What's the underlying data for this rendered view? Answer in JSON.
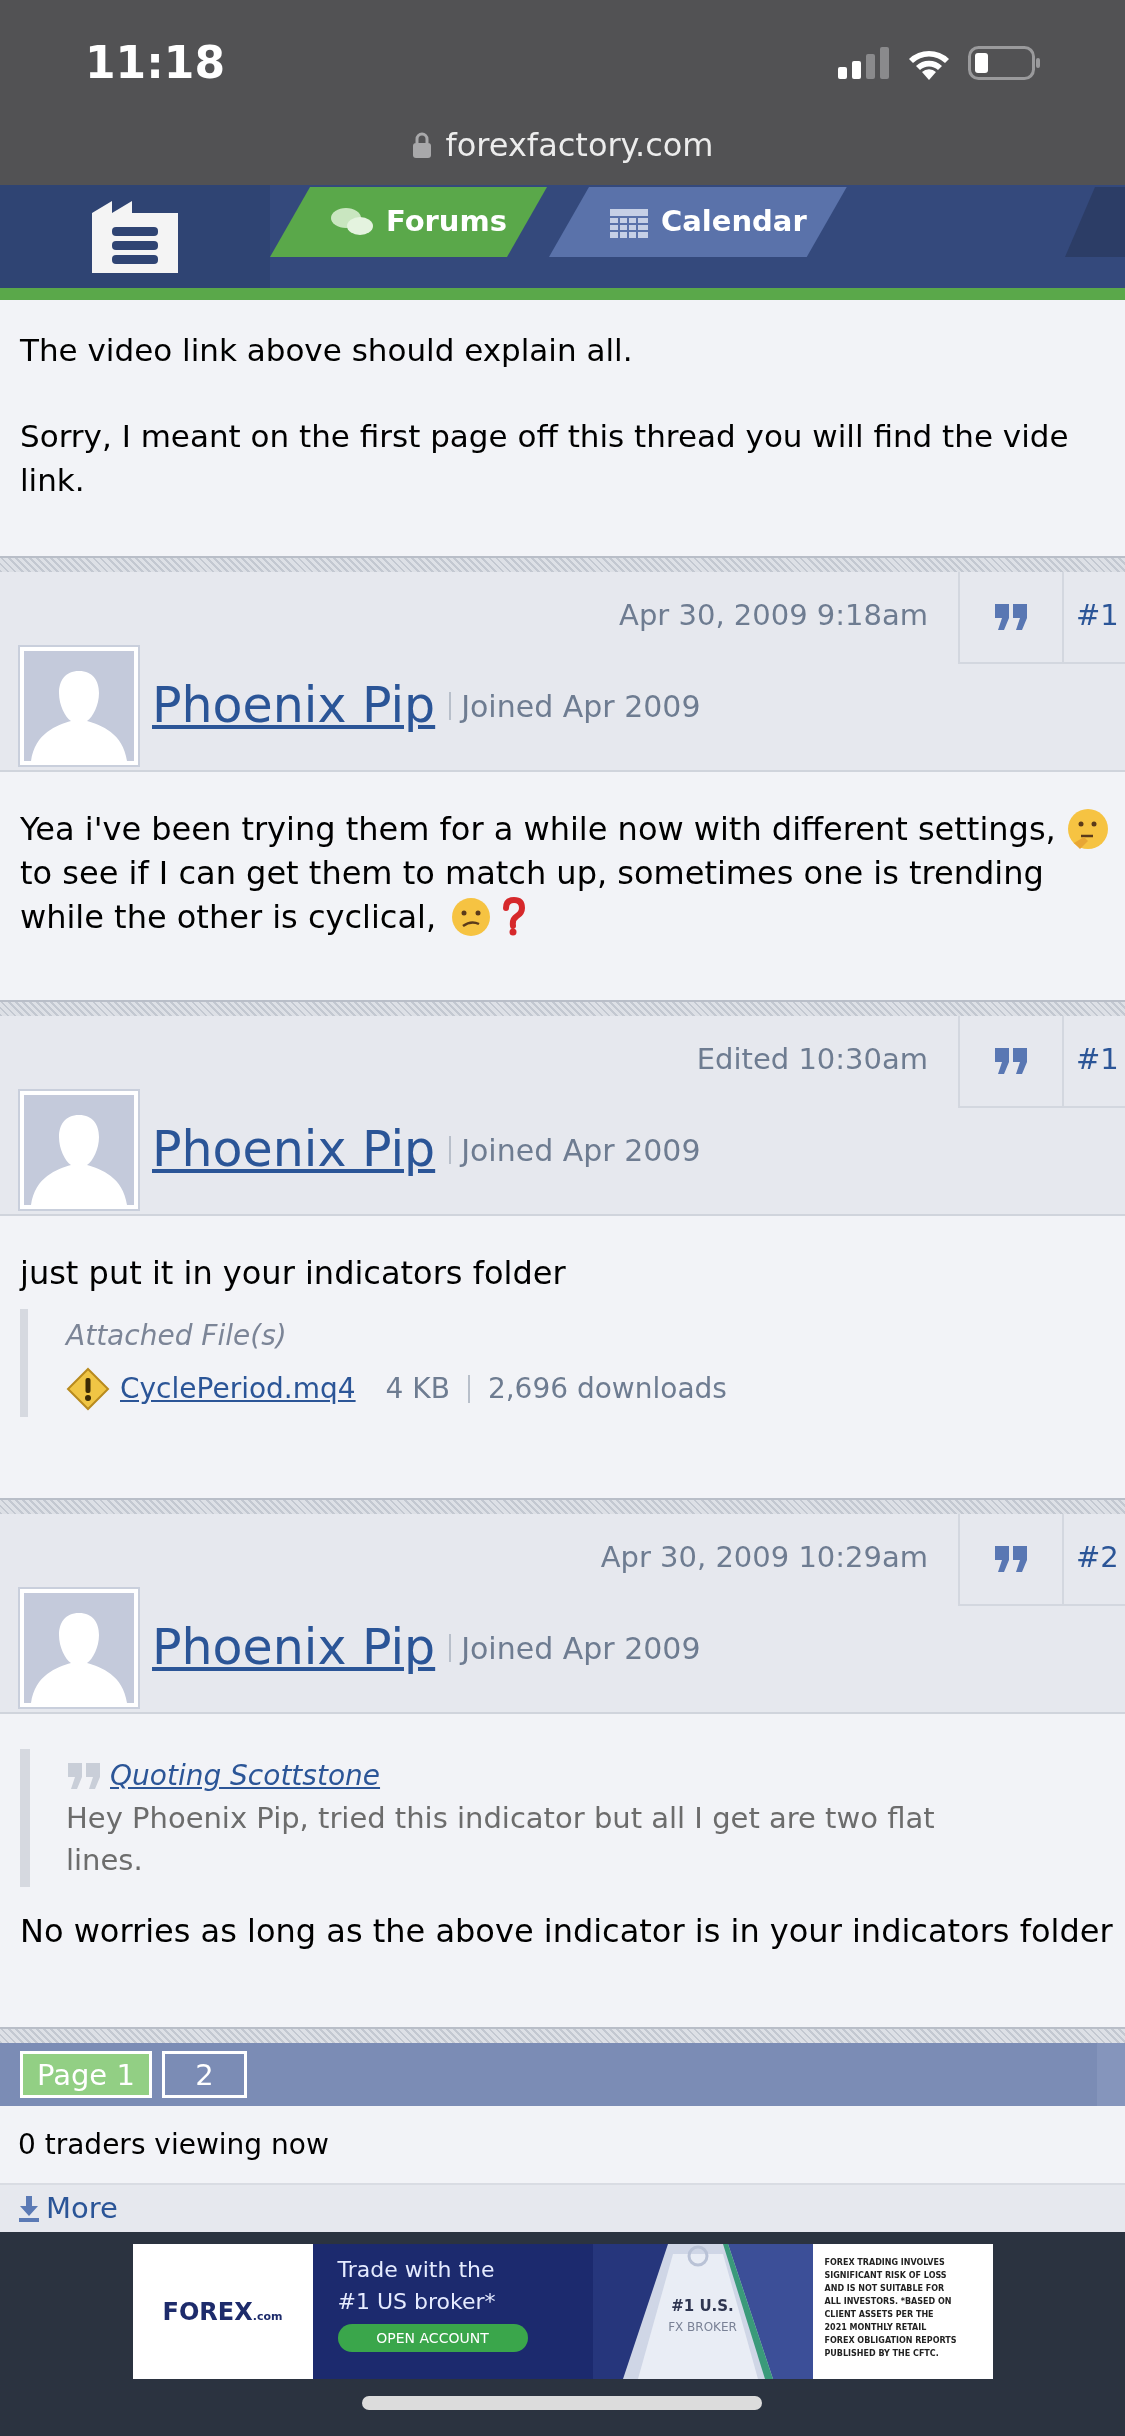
{
  "status_bar": {
    "time": "11:18"
  },
  "address_bar": {
    "url": "forexfactory.com"
  },
  "nav": {
    "tabs": [
      {
        "label": "Forums",
        "selected": true
      },
      {
        "label": "Calendar",
        "selected": false
      }
    ]
  },
  "previous_post_tail": {
    "paragraphs": [
      [
        "The video link above should explain all."
      ],
      [
        "Sorry, I meant on the first page off this thread you will find the vide",
        "link."
      ]
    ]
  },
  "posts": [
    {
      "date": "Apr 30, 2009 9:18am",
      "number": "#1",
      "author": "Phoenix Pip",
      "joined": "Joined Apr 2009",
      "body": [
        {
          "kind": "paragraph",
          "lines": [
            [
              {
                "kind": "text",
                "text": "Yea i've been trying them for a while now with different settings,"
              },
              {
                "kind": "thinking"
              }
            ],
            [
              {
                "kind": "text",
                "text": "to see if I can get them to match up, sometimes one is trending"
              }
            ],
            [
              {
                "kind": "text",
                "text": "while the other is cyclical,"
              },
              {
                "kind": "confused"
              },
              {
                "kind": "question"
              }
            ]
          ]
        }
      ]
    },
    {
      "date": "Edited 10:30am",
      "number": "#1",
      "author": "Phoenix Pip",
      "joined": "Joined Apr 2009",
      "body": [
        {
          "kind": "paragraph",
          "lines": [
            [
              {
                "kind": "text",
                "text": "just put it in your indicators folder"
              }
            ]
          ]
        },
        {
          "kind": "attachments",
          "title": "Attached File(s)",
          "files": [
            {
              "name": "CyclePeriod.mq4",
              "size": "4 KB",
              "downloads": "2,696 downloads"
            }
          ]
        }
      ]
    },
    {
      "date": "Apr 30, 2009 10:29am",
      "number": "#2",
      "author": "Phoenix Pip",
      "joined": "Joined Apr 2009",
      "body": [
        {
          "kind": "quote",
          "link": "Quoting Scottstone",
          "lines": [
            "Hey Phoenix Pip, tried this indicator but all I get are two flat",
            "lines."
          ]
        },
        {
          "kind": "paragraph",
          "lines": [
            [
              {
                "kind": "text",
                "text": "No worries as long as the above indicator is in your indicators folder"
              }
            ]
          ]
        }
      ]
    }
  ],
  "pagination": {
    "pages": [
      {
        "label": "Page 1",
        "selected": true
      },
      {
        "label": "2",
        "selected": false
      }
    ]
  },
  "viewers": "0 traders viewing now",
  "more_link": "More",
  "ad": {
    "brand": "FOREX",
    "brand_suffix": ".com",
    "headline": [
      "Trade with the",
      "#1 US broker*"
    ],
    "button": "OPEN ACCOUNT",
    "award": [
      "#1 U.S.",
      "FX BROKER"
    ],
    "disclaimer": [
      "FOREX TRADING INVOLVES",
      "SIGNIFICANT RISK OF LOSS",
      "AND IS NOT SUITABLE FOR",
      "ALL INVESTORS. *BASED ON",
      "CLIENT ASSETS PER THE",
      "2021 MONTHLY RETAIL",
      "FOREX OBLIGATION REPORTS",
      "PUBLISHED BY THE CFTC."
    ]
  }
}
